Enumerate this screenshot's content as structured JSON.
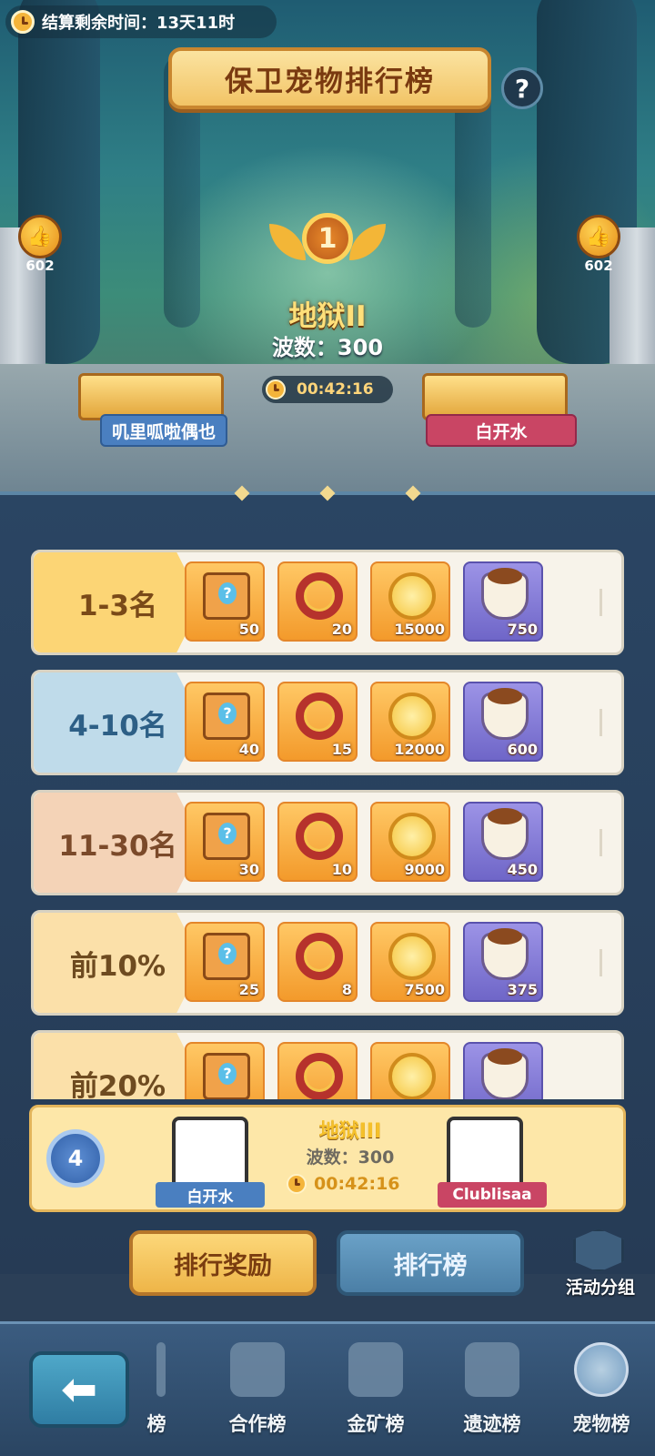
{
  "header": {
    "settlement_text": "结算剩余时间：13天11时",
    "title": "保卫宠物排行榜",
    "help_symbol": "?"
  },
  "podium": {
    "left_likes": "602",
    "right_likes": "602",
    "rank_number": "1",
    "tier": "地狱II",
    "waves": "波数：300",
    "time": "00:42:16",
    "left_player": "叽里呱啦偶也",
    "right_player": "白开水"
  },
  "rewards": [
    {
      "label": "1-3名",
      "items": [
        {
          "icon": "mystery-chest-icon",
          "qty": "50"
        },
        {
          "icon": "pet-collar-icon",
          "qty": "20"
        },
        {
          "icon": "fox-coin-icon",
          "qty": "15000"
        },
        {
          "icon": "pet-food-bowl-icon",
          "qty": "750"
        }
      ]
    },
    {
      "label": "4-10名",
      "items": [
        {
          "icon": "mystery-chest-icon",
          "qty": "40"
        },
        {
          "icon": "pet-collar-icon",
          "qty": "15"
        },
        {
          "icon": "fox-coin-icon",
          "qty": "12000"
        },
        {
          "icon": "pet-food-bowl-icon",
          "qty": "600"
        }
      ]
    },
    {
      "label": "11-30名",
      "items": [
        {
          "icon": "mystery-chest-icon",
          "qty": "30"
        },
        {
          "icon": "pet-collar-icon",
          "qty": "10"
        },
        {
          "icon": "fox-coin-icon",
          "qty": "9000"
        },
        {
          "icon": "pet-food-bowl-icon",
          "qty": "450"
        }
      ]
    },
    {
      "label": "前10%",
      "items": [
        {
          "icon": "mystery-chest-icon",
          "qty": "25"
        },
        {
          "icon": "pet-collar-icon",
          "qty": "8"
        },
        {
          "icon": "fox-coin-icon",
          "qty": "7500"
        },
        {
          "icon": "pet-food-bowl-icon",
          "qty": "375"
        }
      ]
    },
    {
      "label": "前20%",
      "items": [
        {
          "icon": "mystery-chest-icon",
          "qty": ""
        },
        {
          "icon": "pet-collar-icon",
          "qty": ""
        },
        {
          "icon": "fox-coin-icon",
          "qty": ""
        },
        {
          "icon": "pet-food-bowl-icon",
          "qty": ""
        }
      ]
    }
  ],
  "my_rank": {
    "rank": "4",
    "tier": "地狱III",
    "waves": "波数：300",
    "time": "00:42:16",
    "left_player": "白开水",
    "right_player": "Clublisaa"
  },
  "tabs": {
    "rank_rewards": "排行奖励",
    "leaderboard": "排行榜",
    "activity_group": "活动分组"
  },
  "bottom_nav": {
    "back": "⬅",
    "partial": "榜",
    "coop": "合作榜",
    "mine": "金矿榜",
    "relic": "遗迹榜",
    "pet": "宠物榜"
  },
  "colors": {
    "gold": "#f2c466",
    "blue_plate": "#4a7fc0",
    "red_plate": "#c94564",
    "panel": "#2a4563"
  }
}
